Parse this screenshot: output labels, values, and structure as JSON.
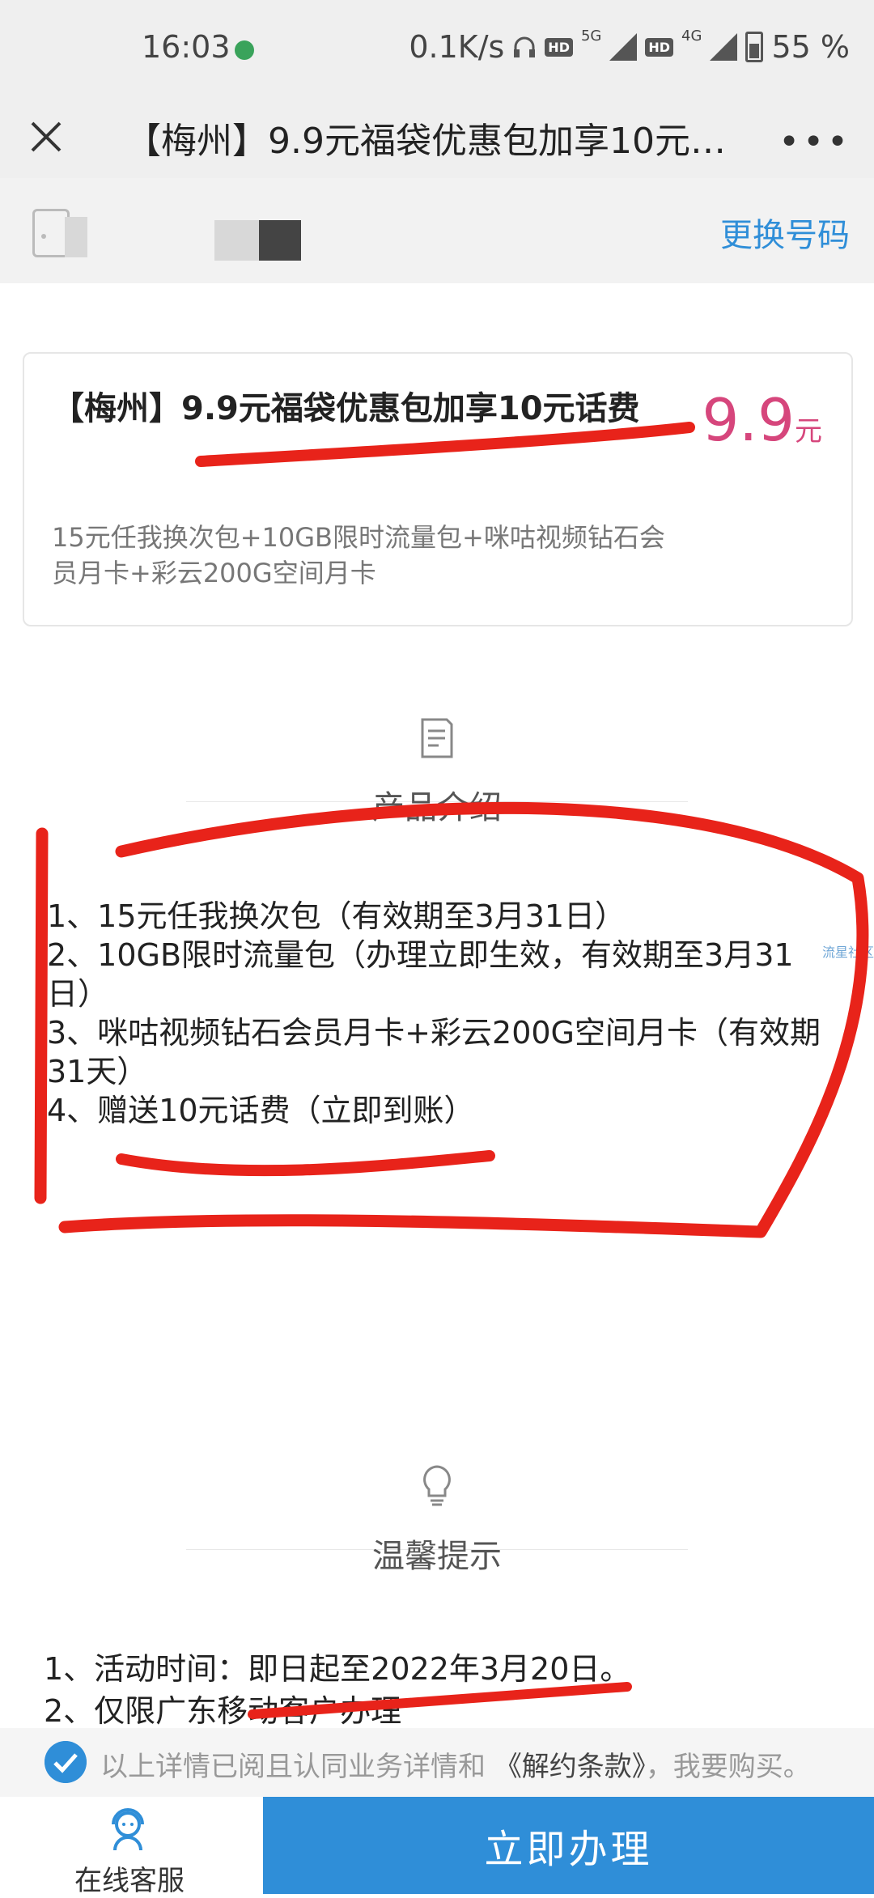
{
  "status_bar": {
    "time": "16:03",
    "net_speed": "0.1K/s",
    "net_type_1": "5G",
    "net_type_2": "4G",
    "hd_label": "HD",
    "battery": "55 %"
  },
  "nav": {
    "title": "【梅州】9.9元福袋优惠包加享10元…"
  },
  "number_bar": {
    "change_label": "更换号码"
  },
  "product": {
    "name": "【梅州】9.9元福袋优惠包加享10元话费",
    "price": "9.9",
    "price_unit": "元",
    "description": "15元任我换次包+10GB限时流量包+咪咕视频钻石会员月卡+彩云200G空间月卡"
  },
  "intro": {
    "header": "产品介绍",
    "items": [
      "1、15元任我换次包（有效期至3月31日）",
      "2、10GB限时流量包（办理立即生效，有效期至3月31日）",
      "3、咪咕视频钻石会员月卡+彩云200G空间月卡（有效期31天）",
      "4、赠送10元话费（立即到账）"
    ]
  },
  "watermark": "流星社区",
  "tips": {
    "header": "温馨提示",
    "items": [
      "1、活动时间：即日起至2022年3月20日。",
      "2、仅限广东移动客户办理"
    ]
  },
  "agreement": {
    "text": "以上详情已阅且认同业务详情和",
    "link": "《解约条款》",
    "suffix": "，我要购买。"
  },
  "bottom_bar": {
    "service_label": "在线客服",
    "apply_label": "立即办理"
  },
  "colors": {
    "accent": "#2f8ed8",
    "price": "#d6467c",
    "annotation": "#e8231a"
  }
}
